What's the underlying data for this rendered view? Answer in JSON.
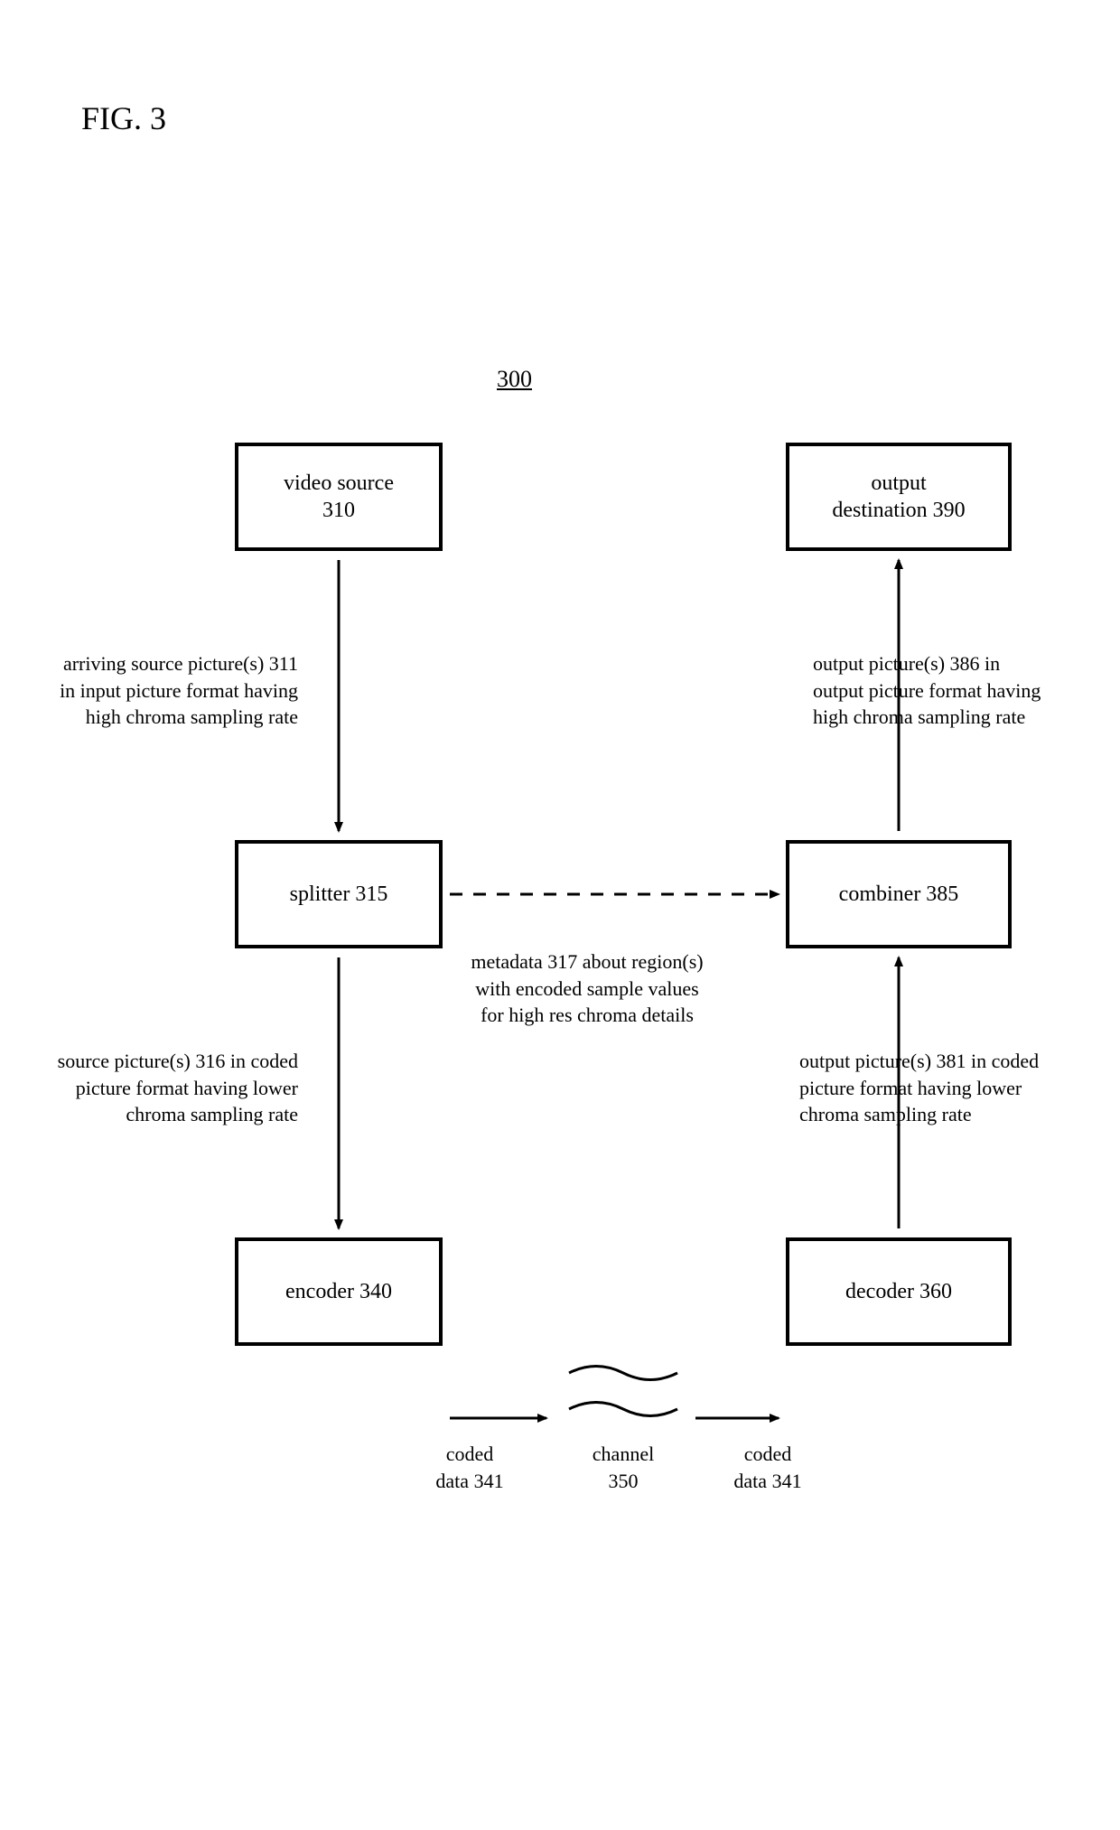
{
  "figure": {
    "title": "FIG. 3",
    "ref": "300"
  },
  "boxes": {
    "video_source": "video source\n310",
    "splitter": "splitter 315",
    "encoder": "encoder 340",
    "output_destination": "output\ndestination 390",
    "combiner": "combiner 385",
    "decoder": "decoder 360"
  },
  "labels": {
    "arriving_source": "arriving source picture(s) 311\nin input picture format having\nhigh chroma sampling rate",
    "source_coded": "source picture(s) 316 in coded\npicture format having lower\nchroma sampling rate",
    "metadata": "metadata 317 about region(s)\nwith encoded sample values\nfor high res chroma details",
    "coded_data_left": "coded\ndata 341",
    "channel": "channel\n350",
    "coded_data_right": "coded\ndata 341",
    "output_high": "output picture(s) 386 in\noutput picture format having\nhigh chroma sampling rate",
    "output_coded": "output picture(s) 381 in coded\npicture format having lower\nchroma sampling rate"
  }
}
